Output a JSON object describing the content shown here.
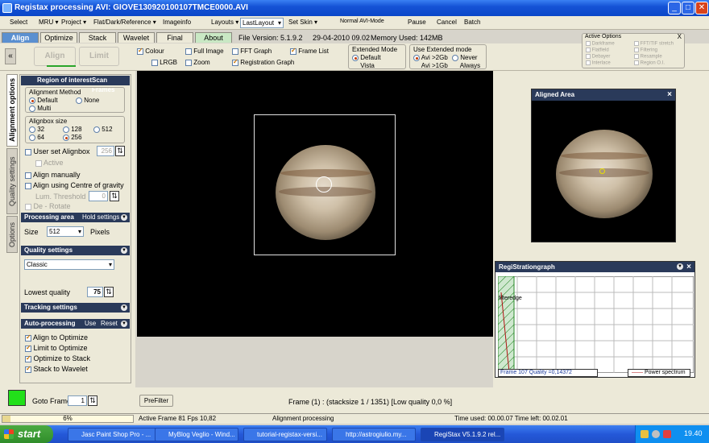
{
  "window": {
    "title": "Registax processing AVI: GIOVE130920100107TMCE0000.AVI",
    "buttons": [
      "_",
      "□",
      "✕"
    ]
  },
  "menu": {
    "items": [
      "Select",
      "MRU ▾",
      "Project ▾",
      "Flat/Dark/Reference ▾",
      "Imageinfo"
    ],
    "layouts_label": "Layouts ▾",
    "layout_value": "LastLayout",
    "set_skin": "Set Skin ▾",
    "normal_avi_mode": "Normal AVI-Mode",
    "pause": "Pause",
    "cancel": "Cancel",
    "batch": "Batch"
  },
  "tabs": [
    "Align",
    "Optimize",
    "Stack",
    "Wavelet",
    "Final",
    "About"
  ],
  "info": {
    "file_version": "File Version: 5.1.9.2",
    "date": "29-04-2010 09.02",
    "memory": "Memory Used: 142MB"
  },
  "active_options": {
    "title": "Active Options",
    "close": "X",
    "items": [
      "Darkframe",
      "FFT/TIF stretch",
      "Flatfield",
      "Filtering",
      "Debayer",
      "Resample",
      "Interlace",
      "Region O.I."
    ]
  },
  "toolbar": {
    "collapse": "«",
    "align": "Align",
    "limit": "Limit",
    "colour": "Colour",
    "full_image": "Full Image",
    "fft_graph": "FFT Graph",
    "frame_list": "Frame List",
    "lrgb": "LRGB",
    "zoom": "Zoom",
    "registration_graph": "Registration Graph"
  },
  "extended_mode": {
    "title": "Extended Mode",
    "default": "Default",
    "vista": "Vista"
  },
  "use_extended": {
    "title": "Use  Extended mode",
    "avi_2gb": "Avi >2Gb",
    "never": "Never",
    "avi_1gb": "Avi >1Gb",
    "always": "Always"
  },
  "vtabs": [
    "Alignment options",
    "Quality settings",
    "Options"
  ],
  "sidebar": {
    "roi": "Region of interest",
    "scan_frames": "Scan Frames",
    "alignment_method": "Alignment Method",
    "default": "Default",
    "none": "None",
    "multi": "Multi",
    "alignbox_size": "Alignbox size",
    "sizes": [
      "32",
      "128",
      "512",
      "64",
      "256"
    ],
    "user_set_alignbox": "User set Alignbox",
    "user_box_value": "256",
    "active": "Active",
    "align_manually": "Align manually",
    "align_cog": "Align using Centre of gravity",
    "lum_threshold": "Lum. Threshold",
    "lum_value": "0",
    "de_rotate": "De - Rotate",
    "processing_area": "Processing area",
    "hold_settings": "Hold settings",
    "size_label": "Size",
    "size_value": "512",
    "pixels": "Pixels",
    "quality_settings": "Quality settings",
    "quality_method": "Classic",
    "lowest_quality": "Lowest quality",
    "lowest_value": "75",
    "tracking_settings": "Tracking settings",
    "auto_processing": "Auto-processing",
    "use": "Use",
    "reset": "Reset",
    "auto_items": [
      "Align to Optimize",
      "Limit to Optimize",
      "Optimize to Stack",
      "Stack to Wavelet"
    ]
  },
  "aligned_area": {
    "title": "Aligned Area",
    "close": "×"
  },
  "reg_graph": {
    "title": "RegiStrationgraph",
    "close": "×",
    "trace_label": "filteredge",
    "status": "Frame 107 Quality =0,14372",
    "legend": "Power spectrum"
  },
  "frame_bar": {
    "goto_frame": "Goto Frame",
    "frame_value": "1",
    "prefilter": "PreFilter",
    "frame_info": "Frame (1) :   (stacksize 1 / 1351) [Low quality 0,0 %]"
  },
  "status": {
    "progress": "6%",
    "progress_value": 0.06,
    "active_frame": "Active Frame 81 Fps 10,82",
    "alignment": "Alignment processing",
    "time": "Time used: 00.00.07 Time left: 00.02.01"
  },
  "taskbar": {
    "start": "start",
    "items": [
      "Jasc Paint Shop Pro - ...",
      "MyBlog Veglio - Wind...",
      "tutorial-registax-versi...",
      "http://astrogiulio.my...",
      "RegiStax V5.1.9.2 rel..."
    ],
    "clock": "19.40"
  },
  "colors": {
    "title_blue": "#0a46c8",
    "accent_green": "#22e01a",
    "section_dark": "#2a3a5a"
  }
}
